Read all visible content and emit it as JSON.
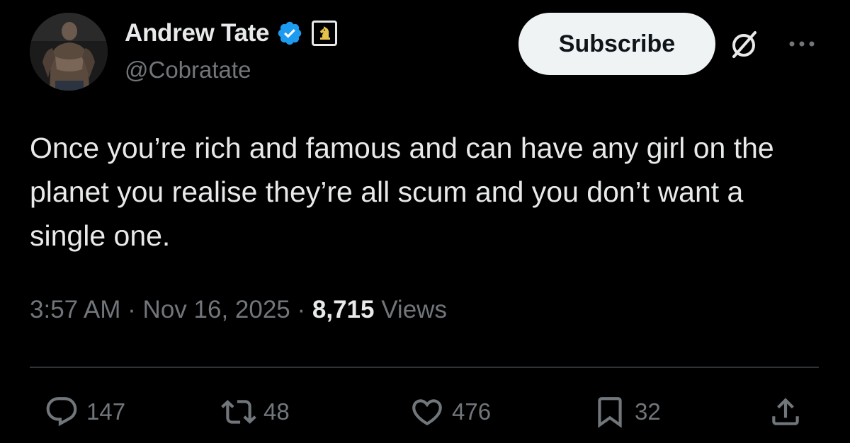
{
  "author": {
    "display_name": "Andrew Tate",
    "handle": "@Cobratate"
  },
  "header": {
    "subscribe_label": "Subscribe"
  },
  "tweet": {
    "text": "Once you’re rich and famous and can have any girl on the planet you realise they’re all scum and you don’t want a single one.",
    "time": "3:57 AM",
    "date": "Nov 16, 2025",
    "views_count": "8,715",
    "views_label": "Views",
    "separator": "·"
  },
  "actions": {
    "replies": "147",
    "reposts": "48",
    "likes": "476",
    "bookmarks": "32"
  },
  "icons": [
    "verified-badge-icon",
    "chess-knight-icon",
    "grok-icon",
    "more-icon",
    "reply-icon",
    "repost-icon",
    "like-icon",
    "bookmark-icon",
    "share-icon"
  ],
  "colors": {
    "background": "#000000",
    "text_primary": "#e7e9ea",
    "text_secondary": "#71767b",
    "verified_blue": "#1d9bf0",
    "divider": "#2f3336",
    "button_bg": "#eff3f4"
  }
}
